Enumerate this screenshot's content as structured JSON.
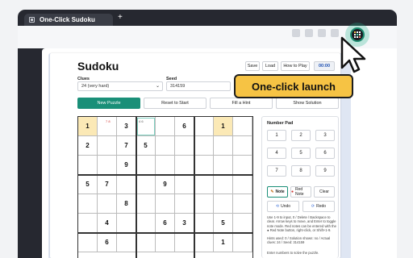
{
  "browser": {
    "tab_title": "One-Click Sudoku",
    "new_tab_label": "+"
  },
  "callout": "One-click launch",
  "app": {
    "title": "Sudoku",
    "top_buttons": [
      "Save",
      "Load",
      "How to Play"
    ],
    "timer": "00:00",
    "clues_label": "Clues",
    "clues_value": "24 (very hard)",
    "seed_label": "Seed",
    "seed_value": "314159",
    "actions": [
      "New Puzzle",
      "Reset to Start",
      "Fill a Hint",
      "Show Solution"
    ]
  },
  "board": {
    "visible_rows": [
      [
        "1",
        "",
        "3",
        "",
        "",
        "6",
        "",
        "1",
        ""
      ],
      [
        "2",
        "",
        "7",
        "5",
        "",
        "",
        "",
        "",
        ""
      ],
      [
        "",
        "",
        "9",
        "",
        "",
        "",
        "",
        "",
        ""
      ],
      [
        "5",
        "7",
        "",
        "",
        "9",
        "",
        "",
        "",
        ""
      ],
      [
        "",
        "",
        "8",
        "",
        "",
        "",
        "",
        "",
        ""
      ],
      [
        "",
        "4",
        "",
        "",
        "6",
        "3",
        "",
        "5",
        ""
      ],
      [
        "",
        "6",
        "",
        "",
        "",
        "",
        "",
        "1",
        ""
      ]
    ],
    "highlighted": [
      [
        0,
        0
      ],
      [
        0,
        7
      ]
    ],
    "selected": [
      0,
      3
    ],
    "pencil_marks": [
      {
        "row": 0,
        "col": 1,
        "text": "7 8",
        "color": "#d0312d"
      },
      {
        "row": 0,
        "col": 3,
        "text": "4 6",
        "color": "#555555"
      }
    ]
  },
  "number_pad": {
    "title": "Number Pad",
    "digits": [
      "1",
      "2",
      "3",
      "4",
      "5",
      "6",
      "7",
      "8",
      "9"
    ],
    "note_label": "Note",
    "red_note_label": "Red Note",
    "clear_label": "Clear",
    "undo_label": "Undo",
    "redo_label": "Redo",
    "help_text": "Use 1-9 to input, 0 / Delete / Backspace to clear. Arrow keys to move, and Enter to toggle note mode. Red notes can be entered with the ● Red Note button, right-click, or Shift+1-9.",
    "stats_text": "Hints used: 0 / Solution shown: no / Actual clues: 24 / Seed: 314159",
    "bottom_text": "Enter numbers to solve the puzzle."
  },
  "colors": {
    "accent": "#1a8f78",
    "callout_bg": "#f6c344",
    "highlight": "#fbe9b6"
  }
}
